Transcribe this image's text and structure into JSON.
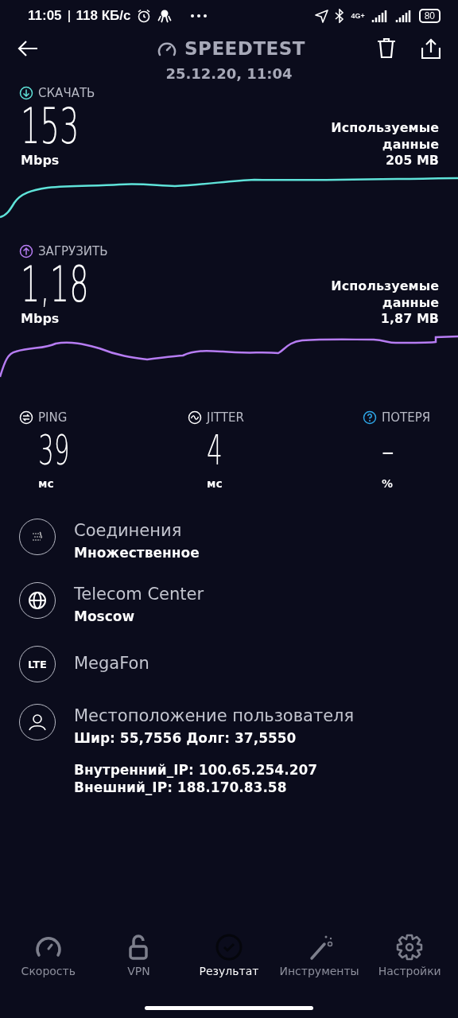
{
  "status_bar": {
    "time": "11:05",
    "net_speed": "118 КБ/с",
    "network": "4G+",
    "battery": "80"
  },
  "header": {
    "title": "SPEEDTEST",
    "date": "25.12.20, 11:04"
  },
  "results": [
    {
      "kind": "download",
      "label": "СКАЧАТЬ",
      "value": "153",
      "unit": "Mbps",
      "data_label": "Используемые данные",
      "data_value": "205 MB"
    },
    {
      "kind": "upload",
      "label": "ЗАГРУЗИТЬ",
      "value": "1,18",
      "unit": "Mbps",
      "data_label": "Используемые данные",
      "data_value": "1,87 MB"
    }
  ],
  "metrics": [
    {
      "kind": "ping",
      "label": "PING",
      "value": "39",
      "unit": "мс"
    },
    {
      "kind": "jitter",
      "label": "JITTER",
      "value": "4",
      "unit": "мс"
    },
    {
      "kind": "loss",
      "label": "ПОТЕРЯ",
      "value": "–",
      "unit": "%"
    }
  ],
  "info": [
    {
      "kind": "connections",
      "title": "Соединения",
      "detail": "Множественное"
    },
    {
      "kind": "server",
      "title": "Telecom Center",
      "detail": "Moscow"
    },
    {
      "kind": "provider",
      "title": "MegaFon",
      "icon_text": "LTE"
    },
    {
      "kind": "location",
      "title": "Местоположение пользователя",
      "detail": "Шир: 55,7556 Долг: 37,5550"
    }
  ],
  "ip": [
    "Внутренний_IP: 100.65.254.207",
    "Внешний_IP: 188.170.83.58"
  ],
  "nav": [
    {
      "kind": "speed",
      "label": "Скорость",
      "selected": false
    },
    {
      "kind": "vpn",
      "label": "VPN",
      "selected": false
    },
    {
      "kind": "result",
      "label": "Результат",
      "selected": true
    },
    {
      "kind": "tools",
      "label": "Инструменты",
      "selected": false
    },
    {
      "kind": "settings",
      "label": "Настройки",
      "selected": false
    }
  ]
}
